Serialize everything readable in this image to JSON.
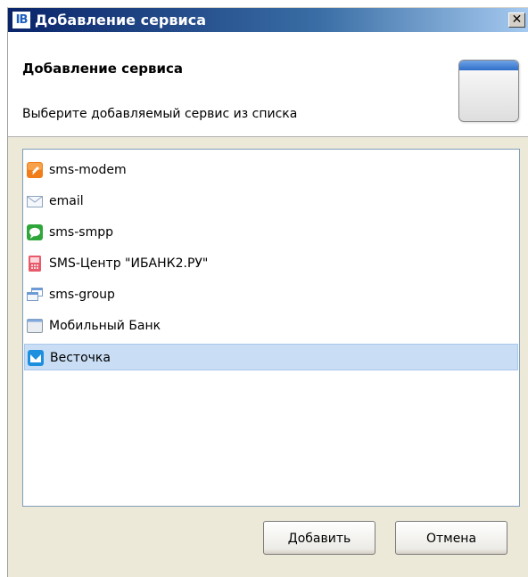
{
  "window": {
    "title": "Добавление сервиса",
    "app_icon_text": "IB"
  },
  "header": {
    "title": "Добавление сервиса",
    "description": "Выберите добавляемый сервис из списка"
  },
  "services": [
    {
      "label": "sms-modem",
      "icon": "modem-icon",
      "selected": false
    },
    {
      "label": "email",
      "icon": "envelope-icon",
      "selected": false
    },
    {
      "label": "sms-smpp",
      "icon": "chat-bubble-icon",
      "selected": false
    },
    {
      "label": "SMS-Центр \"ИБАНК2.РУ\"",
      "icon": "sms-center-icon",
      "selected": false
    },
    {
      "label": "sms-group",
      "icon": "windows-group-icon",
      "selected": false
    },
    {
      "label": "Мобильный Банк",
      "icon": "window-icon",
      "selected": false
    },
    {
      "label": "Весточка",
      "icon": "vestochka-icon",
      "selected": true
    }
  ],
  "buttons": {
    "add_label": "Добавить",
    "cancel_label": "Отмена"
  },
  "colors": {
    "selection": "#c9ddf5",
    "title_bar": "#0a246a"
  }
}
